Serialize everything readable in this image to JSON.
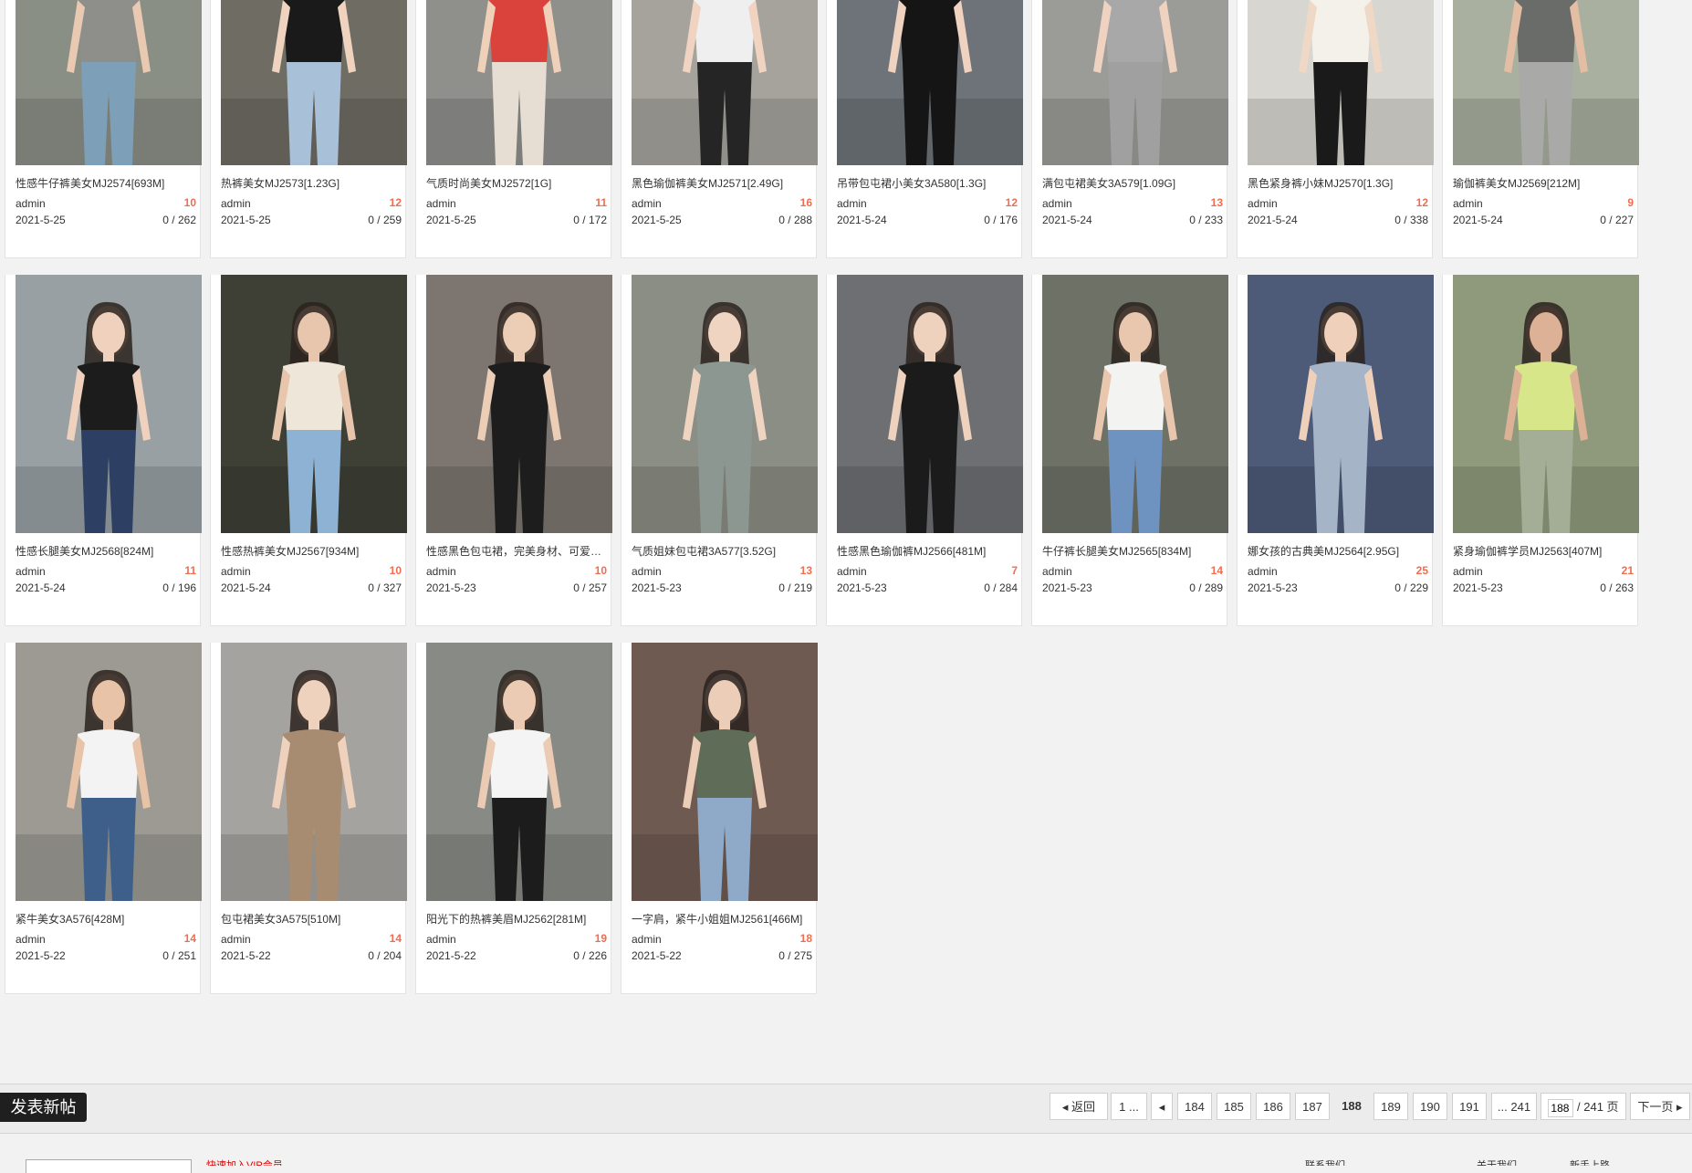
{
  "posts": [
    {
      "title": "性感牛仔裤美女MJ2574[693M]",
      "author": "admin",
      "count": "10",
      "date": "2021-5-25",
      "stats": "0 / 262",
      "bg": "#8a8f86",
      "top": "#8e8f8a",
      "bottom": "#7e9fb8",
      "skin": "#e9c9b2"
    },
    {
      "title": "热裤美女MJ2573[1.23G]",
      "author": "admin",
      "count": "12",
      "date": "2021-5-25",
      "stats": "0 / 259",
      "bg": "#6f6c64",
      "top": "#1a1a1a",
      "bottom": "#a9c1d8",
      "skin": "#efd3bf"
    },
    {
      "title": "气质时尚美女MJ2572[1G]",
      "author": "admin",
      "count": "11",
      "date": "2021-5-25",
      "stats": "0 / 172",
      "bg": "#8f8f8c",
      "top": "#d9433c",
      "bottom": "#e6ddd3",
      "skin": "#efd0b9"
    },
    {
      "title": "黑色瑜伽裤美女MJ2571[2.49G]",
      "author": "admin",
      "count": "16",
      "date": "2021-5-25",
      "stats": "0 / 288",
      "bg": "#a6a39c",
      "top": "#efefef",
      "bottom": "#252525",
      "skin": "#f0d4c1"
    },
    {
      "title": "吊带包屯裙小美女3A580[1.3G]",
      "author": "admin",
      "count": "12",
      "date": "2021-5-24",
      "stats": "0 / 176",
      "bg": "#6d7378",
      "top": "#151515",
      "bottom": "#151515",
      "skin": "#efd3c0"
    },
    {
      "title": "满包屯裙美女3A579[1.09G]",
      "author": "admin",
      "count": "13",
      "date": "2021-5-24",
      "stats": "0 / 233",
      "bg": "#9b9c98",
      "top": "#a8a8a8",
      "bottom": "#a0a0a0",
      "skin": "#efd3c0"
    },
    {
      "title": "黑色紧身裤小妹MJ2570[1.3G]",
      "author": "admin",
      "count": "12",
      "date": "2021-5-24",
      "stats": "0 / 338",
      "bg": "#d8d6d1",
      "top": "#f4f1ea",
      "bottom": "#1a1a1a",
      "skin": "#f0d8c7"
    },
    {
      "title": "瑜伽裤美女MJ2569[212M]",
      "author": "admin",
      "count": "9",
      "date": "2021-5-24",
      "stats": "0 / 227",
      "bg": "#a9b09f",
      "top": "#6a6c6a",
      "bottom": "#a9aaa8",
      "skin": "#e4bea4"
    },
    {
      "title": "性感长腿美女MJ2568[824M]",
      "author": "admin",
      "count": "11",
      "date": "2021-5-24",
      "stats": "0 / 196",
      "bg": "#98a0a3",
      "top": "#1c1c1c",
      "bottom": "#2d3f63",
      "skin": "#efd1bd"
    },
    {
      "title": "性感热裤美女MJ2567[934M]",
      "author": "admin",
      "count": "10",
      "date": "2021-5-24",
      "stats": "0 / 327",
      "bg": "#3e4036",
      "top": "#ede6d9",
      "bottom": "#8db2d4",
      "skin": "#e8c5ad"
    },
    {
      "title": "性感黑色包屯裙，完美身材、可爱脸蛋MJ",
      "author": "admin",
      "count": "10",
      "date": "2021-5-23",
      "stats": "0 / 257",
      "bg": "#7d7670",
      "top": "#1d1d1d",
      "bottom": "#1d1d1d",
      "skin": "#eccdb6"
    },
    {
      "title": "气质姐妹包屯裙3A577[3.52G]",
      "author": "admin",
      "count": "13",
      "date": "2021-5-23",
      "stats": "0 / 219",
      "bg": "#8b8e84",
      "top": "#8c9791",
      "bottom": "#8c9791",
      "skin": "#efd4c1"
    },
    {
      "title": "性感黑色瑜伽裤MJ2566[481M]",
      "author": "admin",
      "count": "7",
      "date": "2021-5-23",
      "stats": "0 / 284",
      "bg": "#6d6f72",
      "top": "#1b1b1b",
      "bottom": "#1b1b1b",
      "skin": "#eed2be"
    },
    {
      "title": "牛仔裤长腿美女MJ2565[834M]",
      "author": "admin",
      "count": "14",
      "date": "2021-5-23",
      "stats": "0 / 289",
      "bg": "#6e7166",
      "top": "#f3f3f1",
      "bottom": "#6e93c0",
      "skin": "#e9c7ae"
    },
    {
      "title": "娜女孩的古典美MJ2564[2.95G]",
      "author": "admin",
      "count": "25",
      "date": "2021-5-23",
      "stats": "0 / 229",
      "bg": "#4d5a78",
      "top": "#a5b4c6",
      "bottom": "#a5b4c6",
      "skin": "#efd1bb"
    },
    {
      "title": "紧身瑜伽裤学员MJ2563[407M]",
      "author": "admin",
      "count": "21",
      "date": "2021-5-23",
      "stats": "0 / 263",
      "bg": "#8f9a7c",
      "top": "#d8e68a",
      "bottom": "#a4ad95",
      "skin": "#dcb195"
    },
    {
      "title": "紧牛美女3A576[428M]",
      "author": "admin",
      "count": "14",
      "date": "2021-5-22",
      "stats": "0 / 251",
      "bg": "#9c9a93",
      "top": "#f3f3f3",
      "bottom": "#3d5f8a",
      "skin": "#e8c3a8"
    },
    {
      "title": "包屯裙美女3A575[510M]",
      "author": "admin",
      "count": "14",
      "date": "2021-5-22",
      "stats": "0 / 204",
      "bg": "#a4a3a0",
      "top": "#a78c72",
      "bottom": "#a78c72",
      "skin": "#efd2bd"
    },
    {
      "title": "阳光下的热裤美眉MJ2562[281M]",
      "author": "admin",
      "count": "19",
      "date": "2021-5-22",
      "stats": "0 / 226",
      "bg": "#888a85",
      "top": "#f4f4f4",
      "bottom": "#1c1c1c",
      "skin": "#ebcbb4"
    },
    {
      "title": "一字肩，紧牛小姐姐MJ2561[466M]",
      "author": "admin",
      "count": "18",
      "date": "2021-5-22",
      "stats": "0 / 275",
      "bg": "#6f5a52",
      "top": "#5f6d58",
      "bottom": "#8eaac8",
      "skin": "#ecceb8"
    }
  ],
  "toolbar": {
    "post_label": "发表新帖",
    "back_label": "◂ 返回",
    "first_label": "1 ...",
    "prev_icon": "◂",
    "pages": [
      "184",
      "185",
      "186",
      "187",
      "188",
      "189",
      "190",
      "191"
    ],
    "current_page": "188",
    "last_label": "... 241",
    "page_input_value": "188",
    "page_total": " / 241 页",
    "next_label": "下一页 ▸"
  },
  "footer": {
    "red_text": "快速加入VIP会员",
    "link1": "联系我们",
    "link2": "关于我们",
    "link3": "新手上路"
  },
  "colors": {
    "accent_count": "#f26c4f",
    "post_button": "#1f1f1f"
  }
}
